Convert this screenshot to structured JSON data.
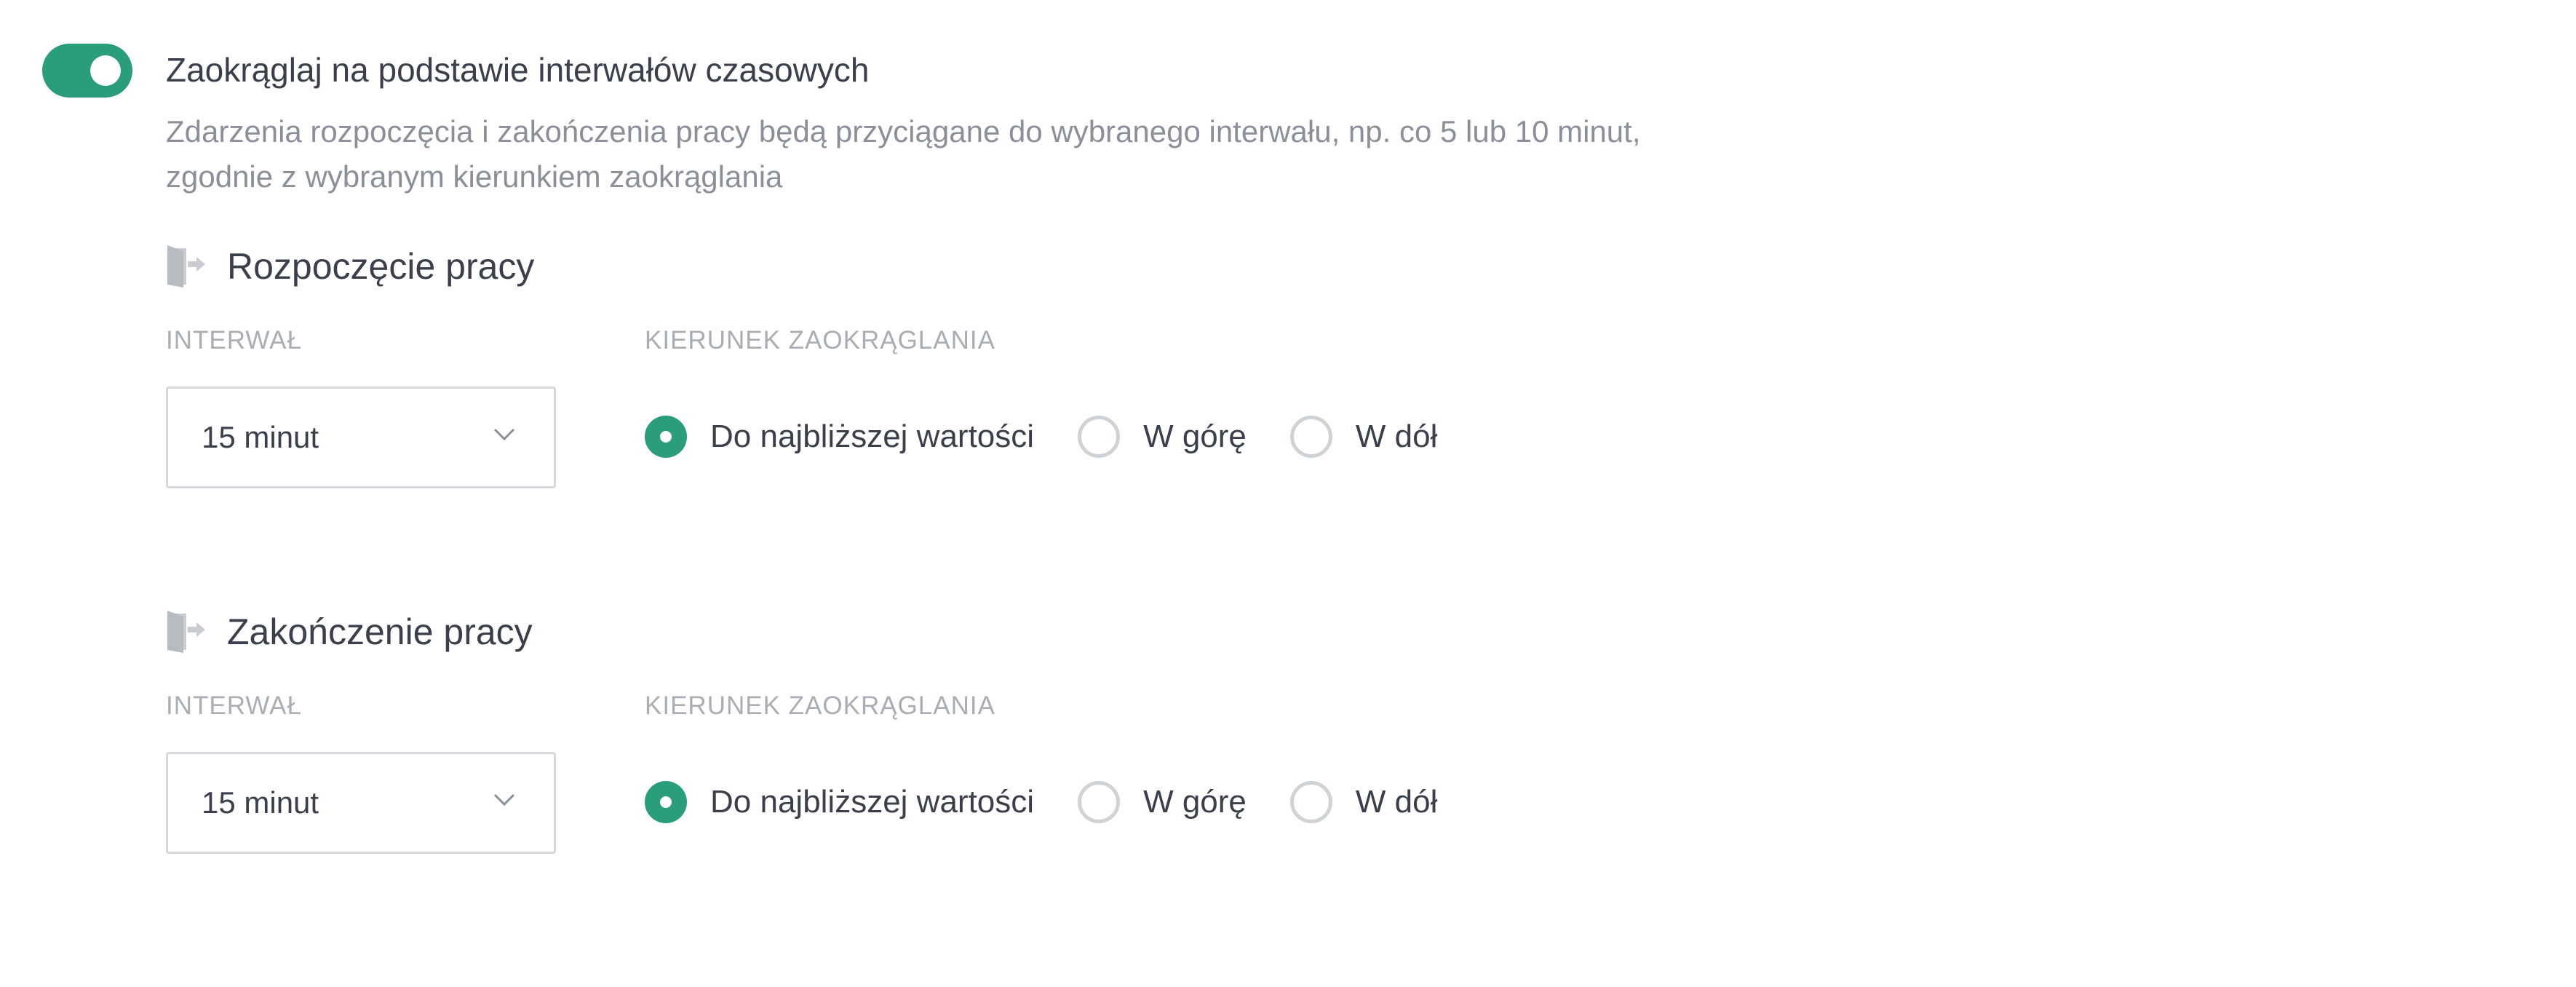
{
  "rounding": {
    "enabled": true,
    "title": "Zaokrąglaj na podstawie interwałów czasowych",
    "description_line1": "Zdarzenia rozpoczęcia i zakończenia pracy będą przyciągane do wybranego interwału, np. co 5 lub 10 minut,",
    "description_line2": "zgodnie z wybranym kierunkiem zaokrąglania"
  },
  "sections": [
    {
      "title": "Rozpoczęcie pracy",
      "icon": "door-exit-icon",
      "interval_label": "INTERWAŁ",
      "interval_value": "15 minut",
      "direction_label": "KIERUNEK ZAOKRĄGLANIA",
      "options": [
        "Do najbliższej wartości",
        "W górę",
        "W dół"
      ],
      "selected_option": "Do najbliższej wartości"
    },
    {
      "title": "Zakończenie pracy",
      "icon": "door-exit-icon",
      "interval_label": "INTERWAŁ",
      "interval_value": "15 minut",
      "direction_label": "KIERUNEK ZAOKRĄGLANIA",
      "options": [
        "Do najbliższej wartości",
        "W górę",
        "W dół"
      ],
      "selected_option": "Do najbliższej wartości"
    }
  ],
  "colors": {
    "accent": "#2a9d7a",
    "text": "#3a3f4b",
    "muted": "#8a8f99",
    "label": "#a9adb4",
    "border": "#d5d8dc"
  }
}
